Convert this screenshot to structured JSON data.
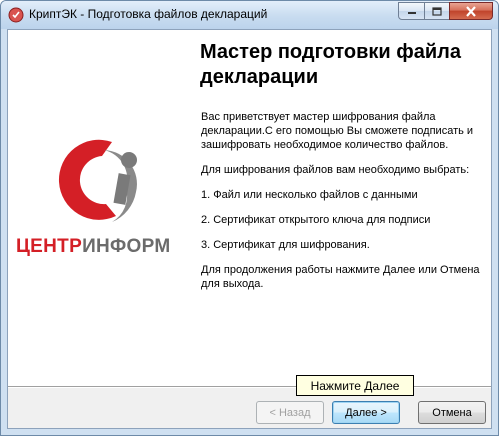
{
  "window": {
    "title": "КриптЭК - Подготовка файлов деклараций",
    "icon": "app-icon"
  },
  "captions": {
    "minimize": "minimize-icon",
    "maximize": "maximize-icon",
    "close": "close-icon"
  },
  "logo": {
    "text_red": "ЦЕНТР",
    "text_gray": "ИНФОРМ",
    "colors": {
      "red": "#d41f26",
      "gray": "#6b6b6b"
    }
  },
  "wizard": {
    "heading": "Мастер подготовки файла декларации",
    "paragraphs": [
      "Вас приветствует мастер шифрования файла декларации.С его помощью Вы сможете подписать и зашифровать необходимое количество файлов.",
      "Для шифрования файлов вам необходимо выбрать:",
      "1. Файл или несколько файлов с данными",
      "2. Сертификат открытого ключа для подписи",
      "3. Сертификат для шифрования.",
      "Для продолжения работы нажмите Далее или Отмена для выхода."
    ]
  },
  "buttons": {
    "back": "< Назад",
    "next": "Далее >",
    "cancel": "Отмена"
  },
  "tooltip": {
    "text": "Нажмите Далее"
  }
}
